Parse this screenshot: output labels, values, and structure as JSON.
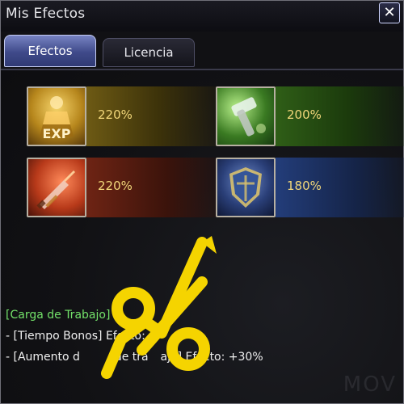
{
  "window": {
    "title": "Mis Efectos",
    "close_symbol": "✕"
  },
  "tabs": [
    {
      "label": "Efectos",
      "state": "active"
    },
    {
      "label": "Licencia",
      "state": "inactive"
    }
  ],
  "effects": [
    {
      "icon": "exp-statue-icon",
      "icon_label": "EXP",
      "percent": "220%",
      "theme": "gold"
    },
    {
      "icon": "hammer-icon",
      "percent": "200%",
      "theme": "green"
    },
    {
      "icon": "sword-icon",
      "percent": "220%",
      "theme": "red"
    },
    {
      "icon": "shield-icon",
      "percent": "180%",
      "theme": "blue"
    }
  ],
  "description": {
    "heading": "[Carga de Trabajo]",
    "lines": [
      "- [Tiempo Bonos] Efecto: +",
      "- [Aumento d",
      "de tra",
      "ajo] Efecto: +30%"
    ],
    "line1_suffix": "%",
    "line2_middle": "e",
    "line2_gap": "",
    "line2_hidden": "",
    "line2_start": "- [Aumento d",
    "line2_end": "ajo] Efecto: +30%"
  },
  "overlay": {
    "symbol": "%",
    "accent_color": "#f5d400"
  },
  "watermark_text": "MOV"
}
